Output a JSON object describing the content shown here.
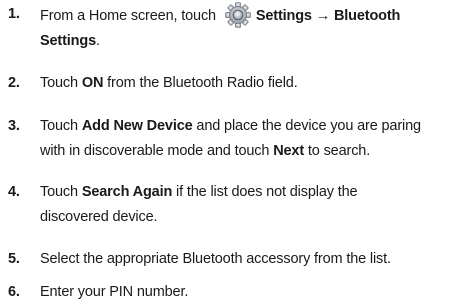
{
  "steps": [
    {
      "number": "1.",
      "parts": [
        "From a Home screen, touch ",
        "Settings → Bluetooth",
        "Settings",
        "."
      ],
      "icon": "settings-gear-icon"
    },
    {
      "number": "2.",
      "parts": [
        "Touch ",
        "ON",
        " from the Bluetooth Radio field."
      ]
    },
    {
      "number": "3.",
      "parts": [
        "Touch ",
        "Add New Device",
        " and place the device you are paring",
        "with in discoverable mode and touch ",
        "Next",
        " to search."
      ]
    },
    {
      "number": "4.",
      "parts": [
        "Touch ",
        "Search Again",
        " if the list does not display the",
        "discovered device."
      ]
    },
    {
      "number": "5.",
      "parts": [
        "Select the appropriate Bluetooth accessory from the list."
      ]
    },
    {
      "number": "6.",
      "parts": [
        "Enter your PIN number."
      ]
    }
  ]
}
